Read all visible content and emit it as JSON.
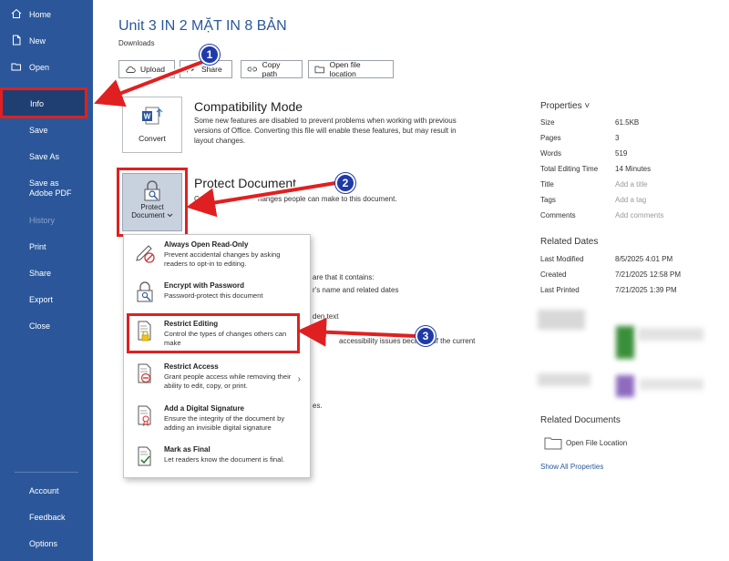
{
  "sidebar": {
    "items": [
      {
        "label": "Home",
        "icon": "home-icon"
      },
      {
        "label": "New",
        "icon": "new-document-icon"
      },
      {
        "label": "Open",
        "icon": "folder-open-icon"
      },
      {
        "label": "Info"
      },
      {
        "label": "Save"
      },
      {
        "label": "Save As"
      },
      {
        "label": "Save as Adobe PDF"
      },
      {
        "label": "History"
      },
      {
        "label": "Print"
      },
      {
        "label": "Share"
      },
      {
        "label": "Export"
      },
      {
        "label": "Close"
      }
    ],
    "bottom": [
      {
        "label": "Account"
      },
      {
        "label": "Feedback"
      },
      {
        "label": "Options"
      }
    ]
  },
  "header": {
    "title": "Unit 3 IN 2 MẶT IN 8 BẢN",
    "path": "Downloads"
  },
  "toolbar": {
    "upload": "Upload",
    "share": "Share",
    "copy_path": "Copy path",
    "open_location": "Open file location"
  },
  "compat": {
    "button": "Convert",
    "title": "Compatibility Mode",
    "text_lines": [
      "Some new features are disabled to prevent problems when working with previous",
      "versions of Office. Converting this file will enable these features, but may result in",
      "layout changes."
    ]
  },
  "protect": {
    "button_line1": "Protect",
    "button_line2": "Document",
    "title": "Protect Document",
    "desc_start": "C",
    "desc_end": "hanges people can make to this document."
  },
  "menu": [
    {
      "title": "Always Open Read-Only",
      "desc": "Prevent accidental changes by asking readers to opt-in to editing."
    },
    {
      "title": "Encrypt with Password",
      "desc": "Password-protect this document"
    },
    {
      "title": "Restrict Editing",
      "desc": "Control the types of changes others can make"
    },
    {
      "title": "Restrict Access",
      "desc": "Grant people access while removing their ability to edit, copy, or print."
    },
    {
      "title": "Add a Digital Signature",
      "desc": "Ensure the integrity of the document by adding an invisible digital signature"
    },
    {
      "title": "Mark as Final",
      "desc": "Let readers know the document is final."
    }
  ],
  "background_fragments": {
    "f1": "are that it contains:",
    "f2": "r's name and related dates",
    "f3": "den text",
    "f4": "accessibility issues because of the current",
    "f5": "es."
  },
  "properties": {
    "heading": "Properties",
    "rows": [
      {
        "key": "Size",
        "value": "61.5KB",
        "muted": false
      },
      {
        "key": "Pages",
        "value": "3",
        "muted": false
      },
      {
        "key": "Words",
        "value": "519",
        "muted": false
      },
      {
        "key": "Total Editing Time",
        "value": "14 Minutes",
        "muted": false
      },
      {
        "key": "Title",
        "value": "Add a title",
        "muted": true
      },
      {
        "key": "Tags",
        "value": "Add a tag",
        "muted": true
      },
      {
        "key": "Comments",
        "value": "Add comments",
        "muted": true
      }
    ]
  },
  "related_dates": {
    "heading": "Related Dates",
    "rows": [
      {
        "key": "Last Modified",
        "value": "8/5/2025 4:01 PM"
      },
      {
        "key": "Created",
        "value": "7/21/2025 12:58 PM"
      },
      {
        "key": "Last Printed",
        "value": "7/21/2025 1:39 PM"
      }
    ]
  },
  "related_docs": {
    "heading": "Related Documents",
    "open_location": "Open File Location",
    "show_all": "Show All Properties"
  },
  "callouts": [
    "1",
    "2",
    "3"
  ],
  "colors": {
    "sidebar": "#2b579a",
    "highlight": "#e02020",
    "badge": "#1f3aa8"
  }
}
